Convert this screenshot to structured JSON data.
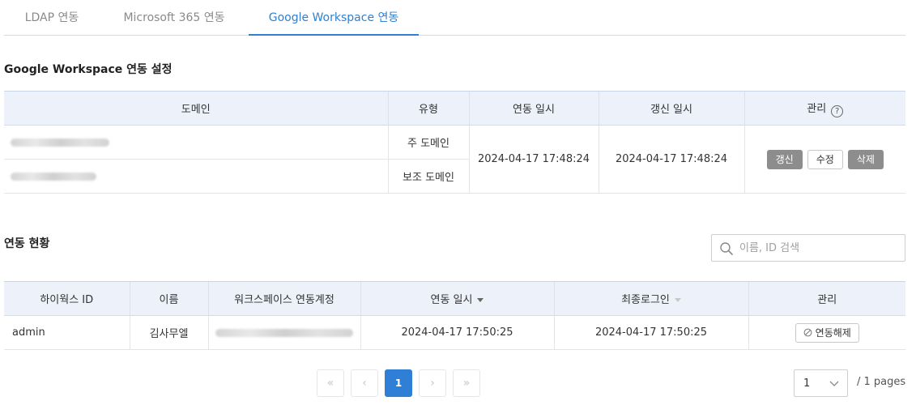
{
  "tabs": [
    {
      "label": "LDAP 연동",
      "active": false
    },
    {
      "label": "Microsoft 365 연동",
      "active": false
    },
    {
      "label": "Google Workspace 연동",
      "active": true
    }
  ],
  "settings": {
    "title": "Google Workspace 연동 설정",
    "columns": [
      "도메인",
      "유형",
      "연동 일시",
      "갱신 일시",
      "관리"
    ],
    "rows": [
      {
        "domain": "",
        "type": "주 도메인"
      },
      {
        "domain": "",
        "type": "보조 도메인"
      }
    ],
    "linked_at": "2024-04-17 17:48:24",
    "updated_at": "2024-04-17 17:48:24",
    "help_glyph": "?",
    "buttons": {
      "refresh": "갱신",
      "edit": "수정",
      "delete": "삭제"
    }
  },
  "status": {
    "title": "연동 현황",
    "search": {
      "placeholder": "이름, ID 검색",
      "value": ""
    },
    "columns": [
      "하이웍스 ID",
      "이름",
      "워크스페이스 연동계정",
      "연동 일시",
      "최종로그인",
      "관리"
    ],
    "rows": [
      {
        "id": "admin",
        "name": "김사무엘",
        "account": "",
        "linked_at": "2024-04-17 17:50:25",
        "last_login": "2024-04-17 17:50:25",
        "action": "연동해제"
      }
    ]
  },
  "pagination": {
    "first": "«",
    "prev": "‹",
    "current": "1",
    "next": "›",
    "last": "»",
    "selected_page": "1",
    "total_label": "/ 1 pages"
  },
  "icons": {
    "search": "search-icon",
    "help": "help-icon",
    "unlink": "ban-icon",
    "dropdown": "chevron-down-icon"
  },
  "colors": {
    "accent": "#2f80d1",
    "header_bg": "#ecf1fa",
    "gray_button": "#8d8d8d"
  }
}
